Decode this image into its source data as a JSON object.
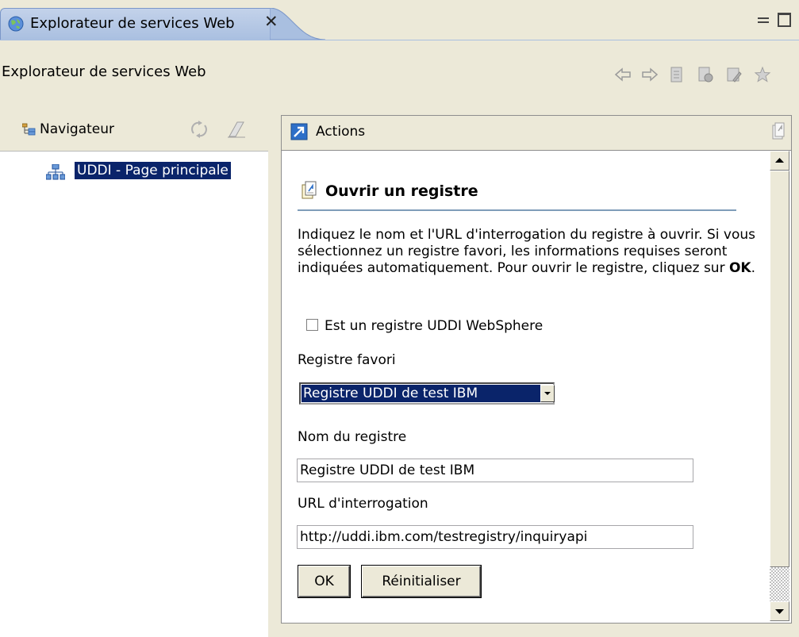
{
  "tab": {
    "title": "Explorateur de services Web",
    "close": "✕"
  },
  "titlebar": {
    "label": "Explorateur de services Web"
  },
  "navigator": {
    "title": "Navigateur",
    "tree": [
      {
        "label": "UDDI - Page principale",
        "selected": true
      }
    ]
  },
  "actions": {
    "title": "Actions",
    "section_title": "Ouvrir un registre",
    "description": {
      "text": "Indiquez le nom et l'URL d'interrogation du registre à ouvrir. Si vous sélectionnez un registre favori, les informations requises seront indiquées automatiquement. Pour ouvrir le registre, cliquez sur ",
      "emph": "OK",
      "end": "."
    },
    "websphere_checkbox": {
      "label": "Est un registre UDDI WebSphere",
      "checked": false
    },
    "favorite": {
      "label": "Registre favori",
      "selected": "Registre UDDI de test IBM"
    },
    "registry_name": {
      "label": "Nom du registre",
      "value": "Registre UDDI de test IBM"
    },
    "inquiry_url": {
      "label": "URL d'interrogation",
      "value": "http://uddi.ibm.com/testregistry/inquiryapi"
    },
    "buttons": {
      "ok": "OK",
      "reset": "Réinitialiser"
    }
  },
  "icons": {
    "tab": "globe-icon",
    "toolbar": [
      "back-arrow-icon",
      "forward-arrow-icon",
      "document-icon",
      "document-settings-icon",
      "properties-icon",
      "favorites-star-icon"
    ],
    "navigator": "navigator-tree-icon",
    "navigator_tools": [
      "refresh-icon",
      "clear-icon"
    ],
    "tree_item": "uddi-registry-icon",
    "actions": "actions-arrow-icon",
    "section": "open-registry-icon"
  },
  "colors": {
    "selection": "#0a246a",
    "tab": "#a9bfe0",
    "background": "#ece9d8"
  }
}
